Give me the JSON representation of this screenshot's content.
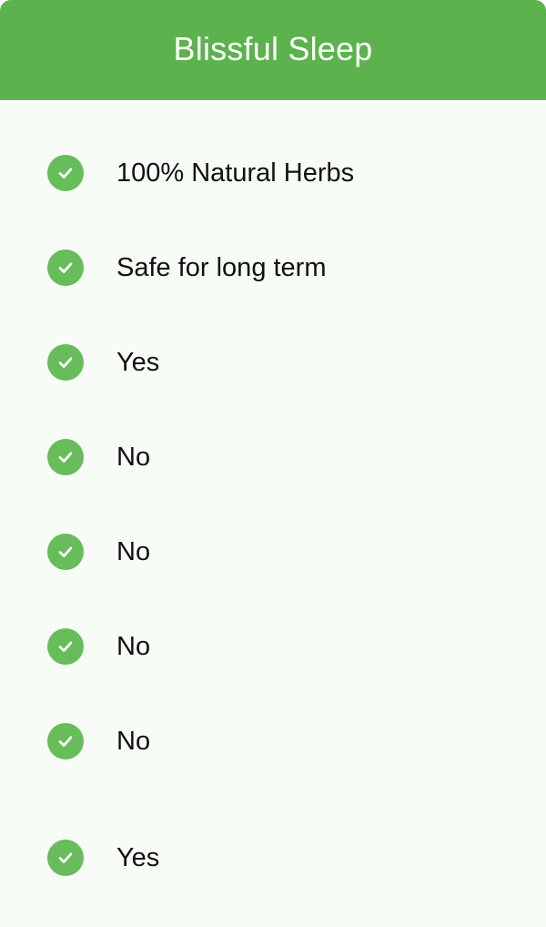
{
  "header": {
    "title": "Blissful Sleep"
  },
  "colors": {
    "header_bg": "#5cb24c",
    "check_bg": "#66bd5a",
    "card_bg": "#f8fcf6"
  },
  "features": {
    "items": [
      {
        "label": "100% Natural Herbs",
        "icon": "check-circle-icon"
      },
      {
        "label": "Safe for long term",
        "icon": "check-circle-icon"
      },
      {
        "label": "Yes",
        "icon": "check-circle-icon"
      },
      {
        "label": "No",
        "icon": "check-circle-icon"
      },
      {
        "label": "No",
        "icon": "check-circle-icon"
      },
      {
        "label": "No",
        "icon": "check-circle-icon"
      },
      {
        "label": "No",
        "icon": "check-circle-icon"
      },
      {
        "label": "Yes",
        "icon": "check-circle-icon"
      }
    ]
  }
}
